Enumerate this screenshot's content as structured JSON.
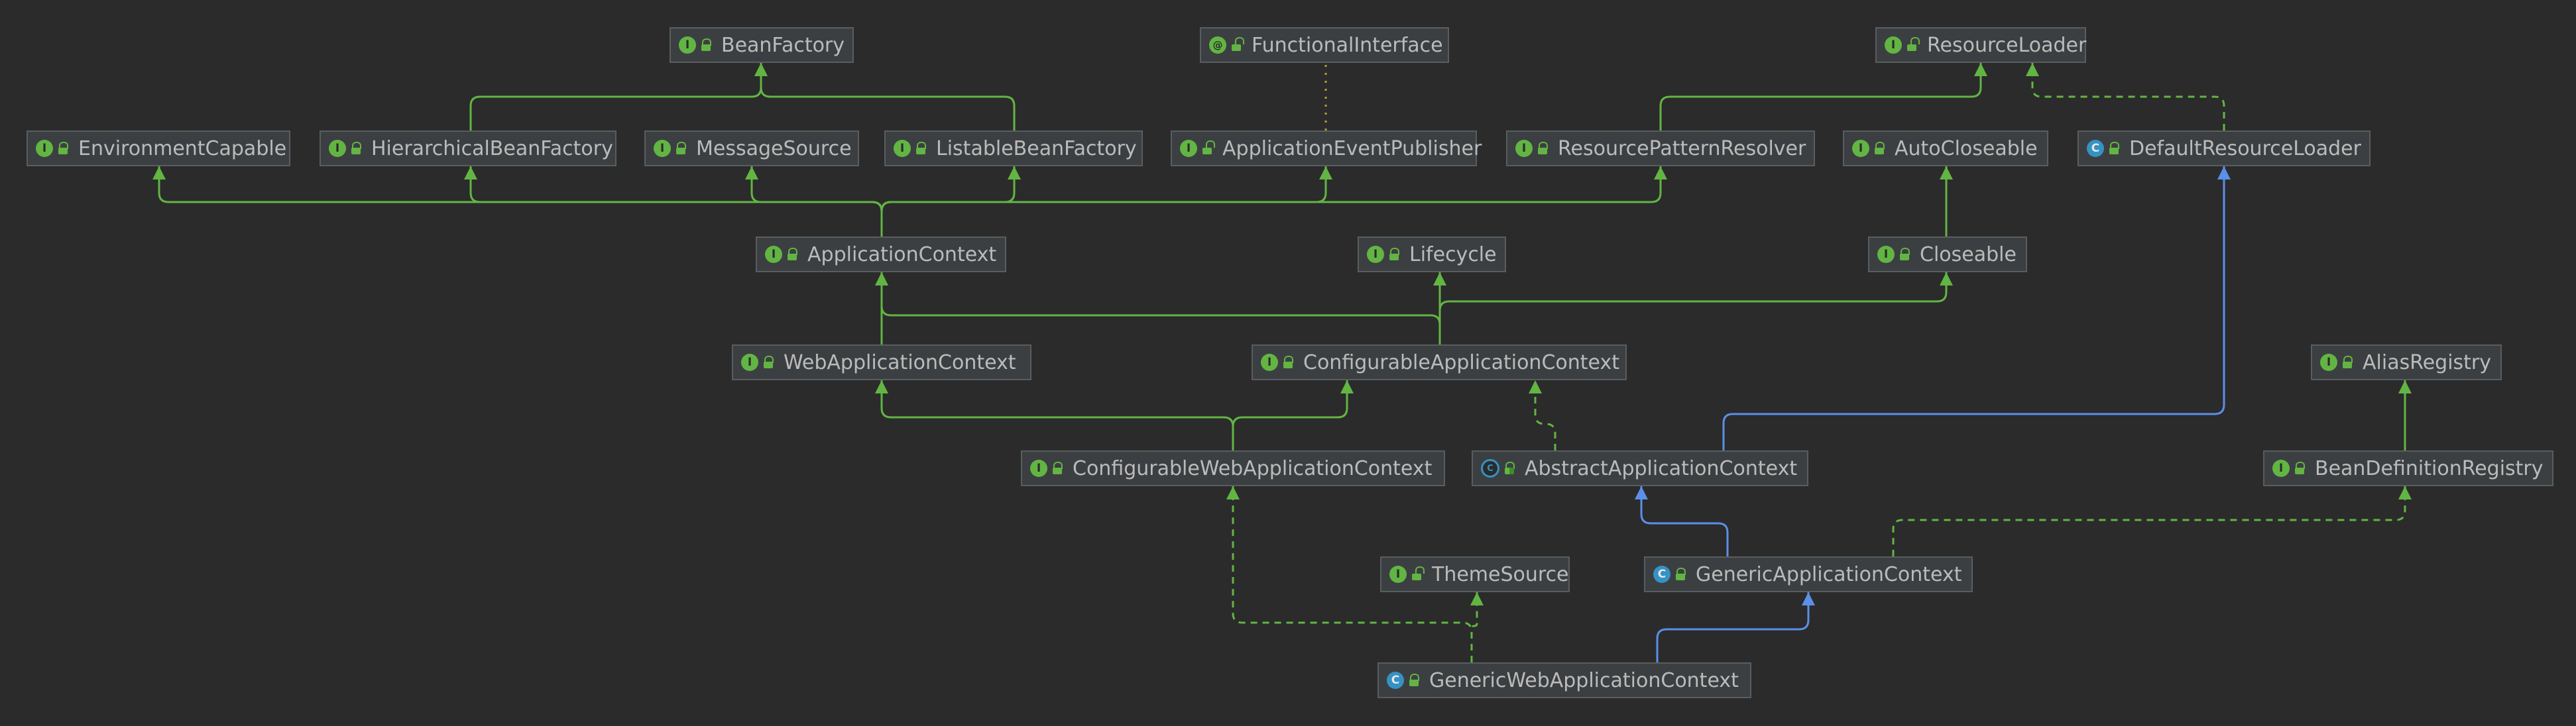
{
  "theme": {
    "background": "#2b2b2b",
    "node_fill": "#3c3f41",
    "node_border": "#5a5d5f",
    "text": "#bbbbbb",
    "extends_interface_color": "#62b543",
    "extends_class_color": "#5b8fe8",
    "implements_color": "#62b543"
  },
  "badges": {
    "interface": "I",
    "class": "C",
    "abstract": "C",
    "annotation": "@"
  },
  "nodes": {
    "BeanFactory": {
      "label": "BeanFactory",
      "kind": "interface",
      "icon": "interface-icon"
    },
    "FunctionalInterface": {
      "label": "FunctionalInterface",
      "kind": "annotation",
      "icon": "annotation-icon"
    },
    "ResourceLoader": {
      "label": "ResourceLoader",
      "kind": "interface",
      "icon": "interface-icon"
    },
    "EnvironmentCapable": {
      "label": "EnvironmentCapable",
      "kind": "interface",
      "icon": "interface-icon"
    },
    "HierarchicalBeanFactory": {
      "label": "HierarchicalBeanFactory",
      "kind": "interface",
      "icon": "interface-icon"
    },
    "MessageSource": {
      "label": "MessageSource",
      "kind": "interface",
      "icon": "interface-icon"
    },
    "ListableBeanFactory": {
      "label": "ListableBeanFactory",
      "kind": "interface",
      "icon": "interface-icon"
    },
    "ApplicationEventPublisher": {
      "label": "ApplicationEventPublisher",
      "kind": "interface",
      "icon": "interface-icon"
    },
    "ResourcePatternResolver": {
      "label": "ResourcePatternResolver",
      "kind": "interface",
      "icon": "interface-icon"
    },
    "AutoCloseable": {
      "label": "AutoCloseable",
      "kind": "interface",
      "icon": "interface-icon"
    },
    "DefaultResourceLoader": {
      "label": "DefaultResourceLoader",
      "kind": "class",
      "icon": "class-icon"
    },
    "ApplicationContext": {
      "label": "ApplicationContext",
      "kind": "interface",
      "icon": "interface-icon"
    },
    "Lifecycle": {
      "label": "Lifecycle",
      "kind": "interface",
      "icon": "interface-icon"
    },
    "Closeable": {
      "label": "Closeable",
      "kind": "interface",
      "icon": "interface-icon"
    },
    "WebApplicationContext": {
      "label": "WebApplicationContext",
      "kind": "interface",
      "icon": "interface-icon"
    },
    "ConfigurableApplicationContext": {
      "label": "ConfigurableApplicationContext",
      "kind": "interface",
      "icon": "interface-icon"
    },
    "AliasRegistry": {
      "label": "AliasRegistry",
      "kind": "interface",
      "icon": "interface-icon"
    },
    "ConfigurableWebApplicationContext": {
      "label": "ConfigurableWebApplicationContext",
      "kind": "interface",
      "icon": "interface-icon"
    },
    "AbstractApplicationContext": {
      "label": "AbstractApplicationContext",
      "kind": "abstract",
      "icon": "abstract-class-icon"
    },
    "BeanDefinitionRegistry": {
      "label": "BeanDefinitionRegistry",
      "kind": "interface",
      "icon": "interface-icon"
    },
    "ThemeSource": {
      "label": "ThemeSource",
      "kind": "interface",
      "icon": "interface-icon"
    },
    "GenericApplicationContext": {
      "label": "GenericApplicationContext",
      "kind": "class",
      "icon": "class-icon"
    },
    "GenericWebApplicationContext": {
      "label": "GenericWebApplicationContext",
      "kind": "class",
      "icon": "class-icon"
    }
  },
  "edges": [
    {
      "from": "HierarchicalBeanFactory",
      "to": "BeanFactory",
      "type": "extends"
    },
    {
      "from": "ListableBeanFactory",
      "to": "BeanFactory",
      "type": "extends"
    },
    {
      "from": "ApplicationEventPublisher",
      "to": "FunctionalInterface",
      "type": "annotated"
    },
    {
      "from": "ResourcePatternResolver",
      "to": "ResourceLoader",
      "type": "extends"
    },
    {
      "from": "DefaultResourceLoader",
      "to": "ResourceLoader",
      "type": "implements"
    },
    {
      "from": "ApplicationContext",
      "to": "EnvironmentCapable",
      "type": "extends"
    },
    {
      "from": "ApplicationContext",
      "to": "HierarchicalBeanFactory",
      "type": "extends"
    },
    {
      "from": "ApplicationContext",
      "to": "MessageSource",
      "type": "extends"
    },
    {
      "from": "ApplicationContext",
      "to": "ListableBeanFactory",
      "type": "extends"
    },
    {
      "from": "ApplicationContext",
      "to": "ApplicationEventPublisher",
      "type": "extends"
    },
    {
      "from": "ApplicationContext",
      "to": "ResourcePatternResolver",
      "type": "extends"
    },
    {
      "from": "Closeable",
      "to": "AutoCloseable",
      "type": "extends"
    },
    {
      "from": "WebApplicationContext",
      "to": "ApplicationContext",
      "type": "extends"
    },
    {
      "from": "ConfigurableApplicationContext",
      "to": "ApplicationContext",
      "type": "extends"
    },
    {
      "from": "ConfigurableApplicationContext",
      "to": "Lifecycle",
      "type": "extends"
    },
    {
      "from": "ConfigurableApplicationContext",
      "to": "Closeable",
      "type": "extends"
    },
    {
      "from": "ConfigurableWebApplicationContext",
      "to": "WebApplicationContext",
      "type": "extends"
    },
    {
      "from": "ConfigurableWebApplicationContext",
      "to": "ConfigurableApplicationContext",
      "type": "extends"
    },
    {
      "from": "AbstractApplicationContext",
      "to": "ConfigurableApplicationContext",
      "type": "implements"
    },
    {
      "from": "AbstractApplicationContext",
      "to": "DefaultResourceLoader",
      "type": "extends-class"
    },
    {
      "from": "BeanDefinitionRegistry",
      "to": "AliasRegistry",
      "type": "extends"
    },
    {
      "from": "GenericApplicationContext",
      "to": "AbstractApplicationContext",
      "type": "extends-class"
    },
    {
      "from": "GenericApplicationContext",
      "to": "BeanDefinitionRegistry",
      "type": "implements"
    },
    {
      "from": "GenericWebApplicationContext",
      "to": "GenericApplicationContext",
      "type": "extends-class"
    },
    {
      "from": "GenericWebApplicationContext",
      "to": "ConfigurableWebApplicationContext",
      "type": "implements"
    },
    {
      "from": "GenericWebApplicationContext",
      "to": "ThemeSource",
      "type": "implements"
    }
  ]
}
